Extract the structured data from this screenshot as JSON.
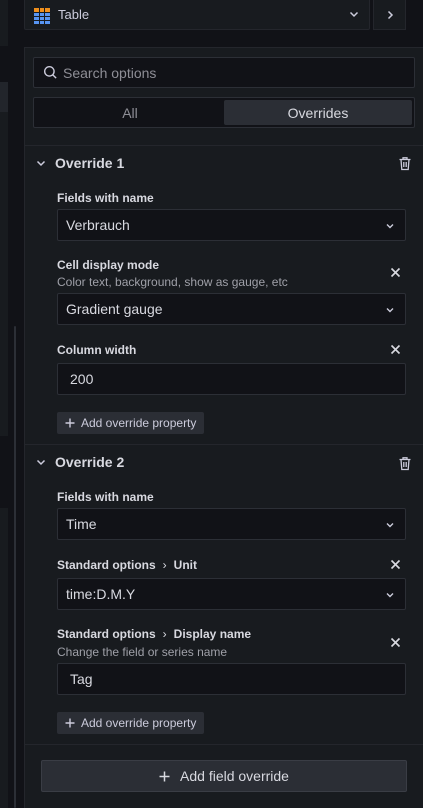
{
  "viz_picker": {
    "name": "Table",
    "colors": {
      "header": "#ef8f1c",
      "cells": "#5794f2"
    }
  },
  "search": {
    "placeholder": "Search options",
    "value": ""
  },
  "tabs": [
    {
      "label": "All",
      "active": false
    },
    {
      "label": "Overrides",
      "active": true
    }
  ],
  "overrides": [
    {
      "title": "Override 1",
      "matcher_label": "Fields with name",
      "matcher_value": "Verbrauch",
      "properties": [
        {
          "label": "Cell display mode",
          "description": "Color text, background, show as gauge, etc",
          "value": "Gradient gauge",
          "kind": "select"
        },
        {
          "label": "Column width",
          "value": "200",
          "kind": "input"
        }
      ],
      "add_property_label": "Add override property"
    },
    {
      "title": "Override 2",
      "matcher_label": "Fields with name",
      "matcher_value": "Time",
      "properties": [
        {
          "category": "Standard options",
          "label": "Unit",
          "value": "time:D.M.Y",
          "kind": "select"
        },
        {
          "category": "Standard options",
          "label": "Display name",
          "description": "Change the field or series name",
          "value": "Tag",
          "kind": "input"
        }
      ],
      "add_property_label": "Add override property"
    }
  ],
  "add_field_override_label": "Add field override",
  "theme": {
    "bg": "#111217",
    "panel": "#181b1f",
    "text": "#ccccdc"
  }
}
